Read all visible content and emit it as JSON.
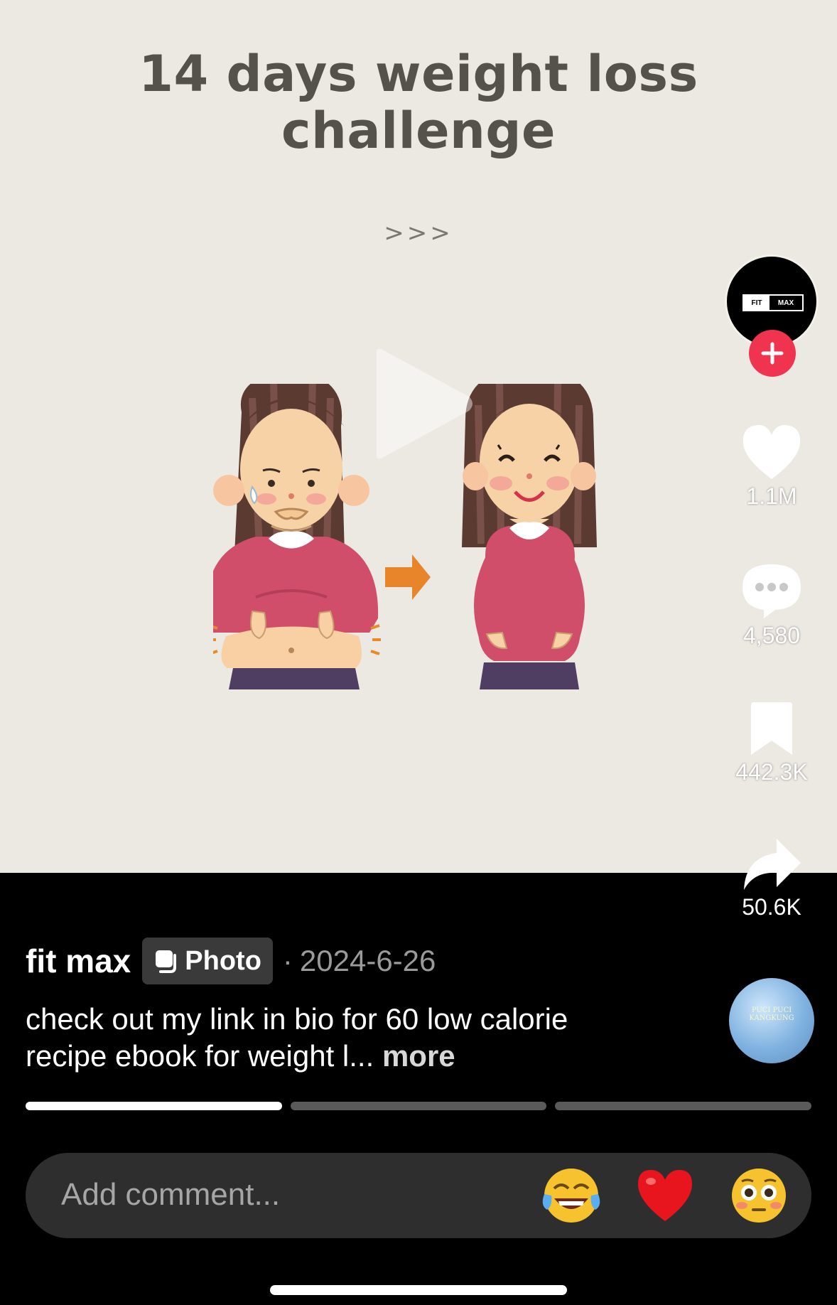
{
  "post": {
    "title_line1": "14 days weight loss",
    "title_line2": "challenge",
    "arrows": ">>>",
    "illustration": "before-after-weight-loss-illustration"
  },
  "creator": {
    "avatar_logo_left": "FIT",
    "avatar_logo_right": "MAX",
    "follow_icon": "plus-icon"
  },
  "actions": {
    "likes": "1.1M",
    "comments": "4,580",
    "saves": "442.3K",
    "shares": "50.6K"
  },
  "meta": {
    "username": "fit max",
    "badge_label": "Photo",
    "date_sep": "·",
    "date": "2024-6-26"
  },
  "caption": {
    "text": "check out my link in bio for 60 low calorie recipe ebook for weight l...",
    "more": "more"
  },
  "music_disc_text": "PUCI PUCI KANGKUNG",
  "progress": {
    "segments": 3,
    "active_index": 0
  },
  "comment": {
    "placeholder": "Add comment...",
    "emojis": [
      "joy-emoji",
      "red-heart-emoji",
      "flushed-emoji"
    ]
  },
  "colors": {
    "post_background": "#ece9e3",
    "title_color": "#55524b",
    "follow_red": "#f0334f",
    "shirt_pink": "#d14e6a"
  }
}
